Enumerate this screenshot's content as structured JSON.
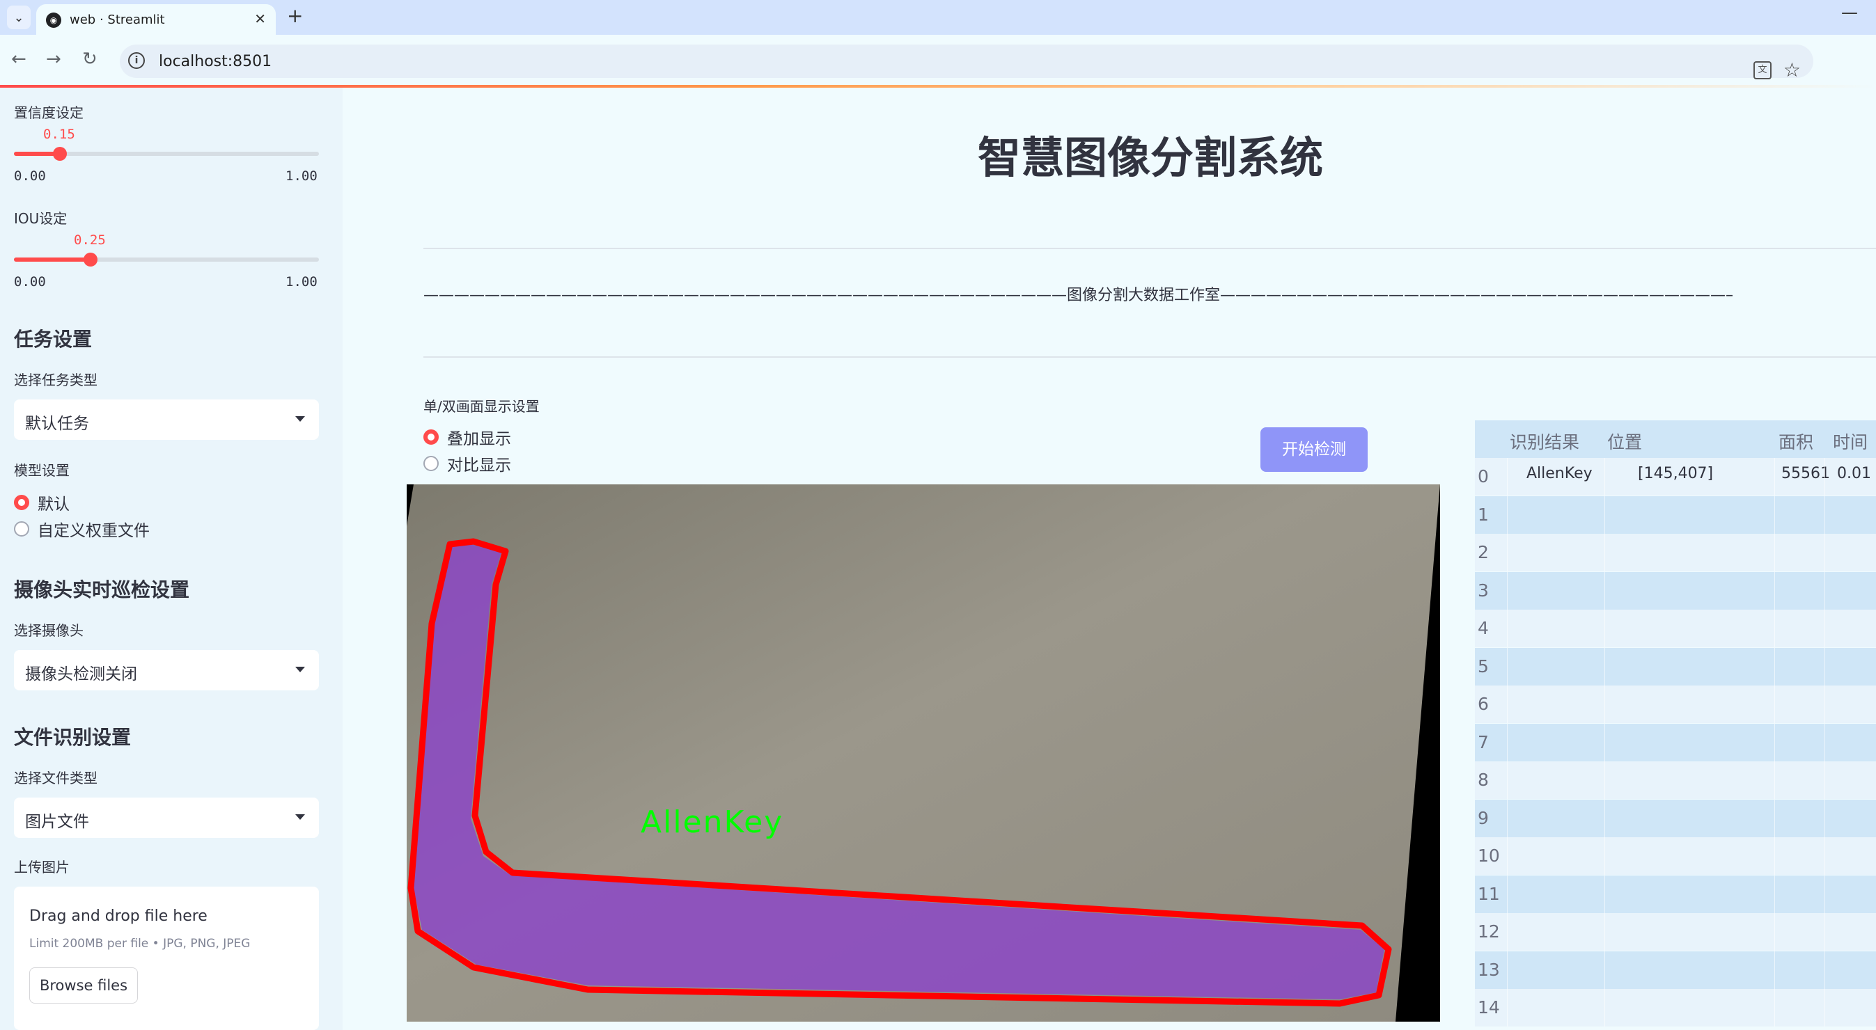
{
  "browser": {
    "tab_title": "web · Streamlit",
    "url": "localhost:8501",
    "favicon_glyph": "◉"
  },
  "sidebar": {
    "confidence": {
      "label": "置信度设定",
      "value": "0.15",
      "min": "0.00",
      "max": "1.00",
      "fraction": 0.15
    },
    "iou": {
      "label": "IOU设定",
      "value": "0.25",
      "min": "0.00",
      "max": "1.00",
      "fraction": 0.25
    },
    "task_heading": "任务设置",
    "task_type_label": "选择任务类型",
    "task_type_value": "默认任务",
    "model_label": "模型设置",
    "model_options": [
      "默认",
      "自定义权重文件"
    ],
    "camera_heading": "摄像头实时巡检设置",
    "camera_label": "选择摄像头",
    "camera_value": "摄像头检测关闭",
    "file_heading": "文件识别设置",
    "file_type_label": "选择文件类型",
    "file_type_value": "图片文件",
    "upload_label": "上传图片",
    "upload_title": "Drag and drop file here",
    "upload_limit": "Limit 200MB per file • JPG, PNG, JPEG",
    "browse_label": "Browse files"
  },
  "main": {
    "title": "智慧图像分割系统",
    "divider_text": "——————————————————————————————————————————图像分割大数据工作室————————————————————————————————————————————",
    "display_label": "单/双画面显示设置",
    "display_options": [
      "叠加显示",
      "对比显示"
    ],
    "detect_button": "开始检测",
    "mask_label": "AllenKey"
  },
  "results_table": {
    "headers": [
      "识别结果",
      "位置",
      "面积",
      "时间"
    ],
    "rows": [
      {
        "idx": "0",
        "result": "AllenKey",
        "position": "[145,407]",
        "area": "55561",
        "time": "0.01"
      },
      {
        "idx": "1",
        "result": "",
        "position": "",
        "area": "",
        "time": ""
      },
      {
        "idx": "2",
        "result": "",
        "position": "",
        "area": "",
        "time": ""
      },
      {
        "idx": "3",
        "result": "",
        "position": "",
        "area": "",
        "time": ""
      },
      {
        "idx": "4",
        "result": "",
        "position": "",
        "area": "",
        "time": ""
      },
      {
        "idx": "5",
        "result": "",
        "position": "",
        "area": "",
        "time": ""
      },
      {
        "idx": "6",
        "result": "",
        "position": "",
        "area": "",
        "time": ""
      },
      {
        "idx": "7",
        "result": "",
        "position": "",
        "area": "",
        "time": ""
      },
      {
        "idx": "8",
        "result": "",
        "position": "",
        "area": "",
        "time": ""
      },
      {
        "idx": "9",
        "result": "",
        "position": "",
        "area": "",
        "time": ""
      },
      {
        "idx": "10",
        "result": "",
        "position": "",
        "area": "",
        "time": ""
      },
      {
        "idx": "11",
        "result": "",
        "position": "",
        "area": "",
        "time": ""
      },
      {
        "idx": "12",
        "result": "",
        "position": "",
        "area": "",
        "time": ""
      },
      {
        "idx": "13",
        "result": "",
        "position": "",
        "area": "",
        "time": ""
      },
      {
        "idx": "14",
        "result": "",
        "position": "",
        "area": "",
        "time": ""
      }
    ]
  },
  "colors": {
    "accent": "#ff4b4b",
    "button": "#8f95f8",
    "mask_outline": "#ff0000",
    "mask_fill": "#9b59d0",
    "label": "#00ff00"
  }
}
